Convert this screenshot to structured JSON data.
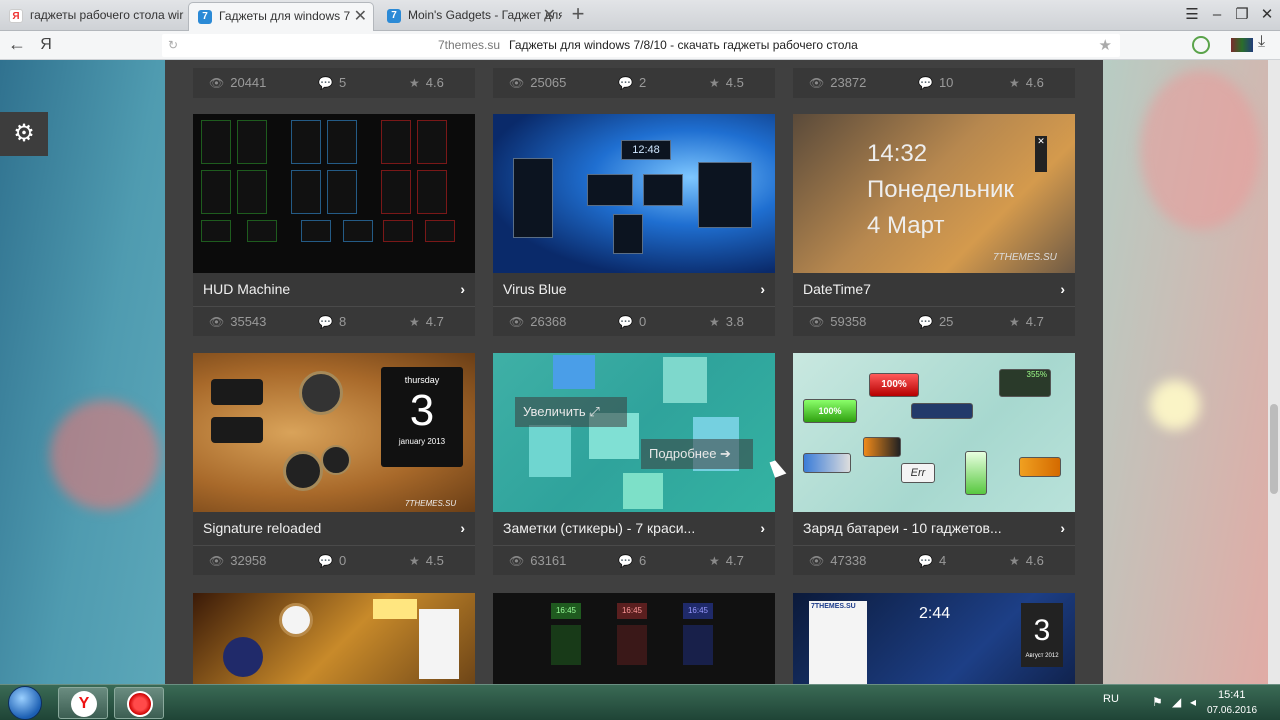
{
  "tabs": [
    {
      "label": "гаджеты рабочего стола wir",
      "favicon": "Я",
      "active": false
    },
    {
      "label": "Гаджеты для windows 7",
      "favicon": "7",
      "active": true
    },
    {
      "label": "Moin's Gadgets - Гаджет для",
      "favicon": "7",
      "active": false
    }
  ],
  "address_bar": {
    "domain": "7themes.su",
    "title": "Гаджеты для windows 7/8/10 - скачать гаджеты рабочего стола",
    "yandex_button": "Я"
  },
  "top_stats": [
    {
      "views": "20441",
      "comments": "5",
      "rating": "4.6"
    },
    {
      "views": "25065",
      "comments": "2",
      "rating": "4.5"
    },
    {
      "views": "23872",
      "comments": "10",
      "rating": "4.6"
    }
  ],
  "cards": [
    {
      "title": "HUD Machine",
      "views": "35543",
      "comments": "8",
      "rating": "4.7"
    },
    {
      "title": "Virus Blue",
      "views": "26368",
      "comments": "0",
      "rating": "3.8"
    },
    {
      "title": "DateTime7",
      "views": "59358",
      "comments": "25",
      "rating": "4.7"
    },
    {
      "title": "Signature reloaded",
      "views": "32958",
      "comments": "0",
      "rating": "4.5"
    },
    {
      "title": "Заметки (стикеры) - 7 краси...",
      "views": "63161",
      "comments": "6",
      "rating": "4.7"
    },
    {
      "title": "Заряд батареи - 10 гаджетов...",
      "views": "47338",
      "comments": "4",
      "rating": "4.6"
    }
  ],
  "datetime_thumb": {
    "time": "14:32",
    "day": "Понедельник",
    "date": "4 Март",
    "watermark": "7THEMES.SU"
  },
  "signature_thumb": {
    "weekday": "thursday",
    "day": "3",
    "month": "january 2013",
    "watermark": "7THEMES.SU"
  },
  "virus_thumb": {
    "clock": "12:48"
  },
  "hover_actions": {
    "zoom": "Увеличить",
    "details": "Подробнее"
  },
  "battery_thumb": {
    "level_red": "100%",
    "level_green": "100%",
    "err": "Err",
    "small": "355%"
  },
  "bottom_thumbs": {
    "clock_right": "2:44",
    "cal_day": "3",
    "cal_month": "Август 2012",
    "site": "7THEMES.SU",
    "hud_time": "16:45"
  },
  "taskbar": {
    "lang": "RU",
    "time": "15:41",
    "date": "07.06.2016",
    "yandex_label": "Y"
  },
  "colors": {
    "content_bg": "#404040",
    "card_bar": "#383838",
    "text_muted": "#9a9a9a"
  }
}
